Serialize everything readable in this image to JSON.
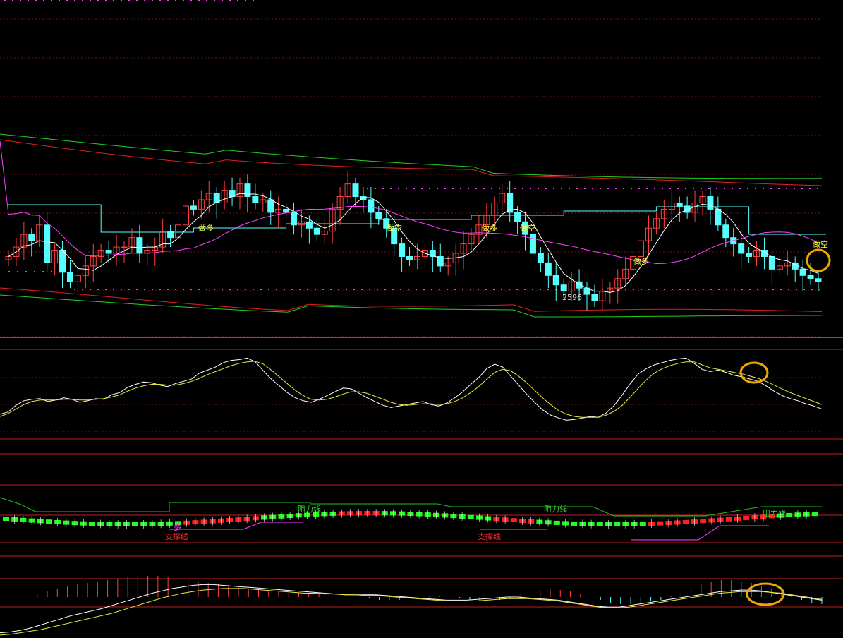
{
  "colors": {
    "background": "#000000",
    "grid": "#7a1010",
    "separator": "#c02020",
    "candle_up": "#ff4040",
    "candle_down": "#55ffff",
    "ma_white": "#ffffff",
    "ma_magenta": "#ff40ff",
    "band_green": "#20d020",
    "band_red": "#e02020",
    "step_cyan": "#55ffff",
    "dot_magenta": "#ff40ff",
    "dot_green": "#20d020",
    "osc_white": "#ffffff",
    "osc_yellow": "#e8e840",
    "label_yellow": "#ffff40",
    "label_green": "#30d030",
    "label_red": "#ff3030",
    "highlight": "#f0a800"
  },
  "labels": {
    "long_1": "做多",
    "short_1": "做空",
    "long_2": "做多",
    "short_2": "做空",
    "long_3": "做多",
    "short_3": "做空",
    "low_value": "2596",
    "resistance_1": "阻力线",
    "resistance_2": "阻力线",
    "resistance_3": "阻力线",
    "support_1": "支撑线",
    "support_2": "支撑线",
    "long_small": "多"
  },
  "chart_data": [
    {
      "type": "candlestick",
      "panel": "price",
      "closes": [
        2612,
        2618,
        2626,
        2622,
        2632,
        2608,
        2616,
        2602,
        2596,
        2600,
        2606,
        2612,
        2616,
        2614,
        2618,
        2618,
        2624,
        2614,
        2616,
        2618,
        2628,
        2624,
        2632,
        2644,
        2642,
        2648,
        2652,
        2646,
        2654,
        2650,
        2658,
        2650,
        2646,
        2648,
        2640,
        2642,
        2640,
        2632,
        2634,
        2630,
        2626,
        2628,
        2642,
        2650,
        2658,
        2650,
        2648,
        2640,
        2636,
        2630,
        2620,
        2612,
        2610,
        2612,
        2616,
        2612,
        2606,
        2608,
        2614,
        2620,
        2626,
        2632,
        2638,
        2646,
        2652,
        2640,
        2634,
        2626,
        2614,
        2608,
        2600,
        2594,
        2590,
        2596,
        2592,
        2588,
        2584,
        2590,
        2592,
        2598,
        2604,
        2612,
        2622,
        2630,
        2636,
        2642,
        2646,
        2644,
        2640,
        2646,
        2650,
        2642,
        2632,
        2624,
        2620,
        2614,
        2612,
        2616,
        2612,
        2604,
        2606,
        2608,
        2604,
        2600,
        2598,
        2596
      ]
    },
    {
      "type": "line",
      "panel": "oscillator",
      "series": [
        {
          "name": "",
          "values": [
            -64,
            -58,
            -40,
            -28,
            -24,
            -22,
            -30,
            -26,
            -20,
            -24,
            -32,
            -28,
            -22,
            -24,
            -12,
            -6,
            8,
            16,
            22,
            20,
            14,
            10,
            18,
            24,
            30,
            46,
            54,
            62,
            74,
            80,
            82,
            86,
            76,
            52,
            30,
            12,
            -6,
            -20,
            -28,
            -32,
            -24,
            -14,
            -4,
            6,
            4,
            -8,
            -20,
            -30,
            -40,
            -46,
            -42,
            -38,
            -34,
            -30,
            -38,
            -42,
            -34,
            -20,
            -4,
            16,
            34,
            58,
            70,
            62,
            38,
            14,
            -10,
            -32,
            -52,
            -66,
            -74,
            -80,
            -78,
            -74,
            -70,
            -72,
            -60,
            -40,
            -12,
            18,
            44,
            58,
            68,
            74,
            80,
            84,
            86,
            72,
            56,
            50,
            54,
            48,
            40,
            36,
            30,
            24,
            12,
            -2,
            -14,
            -22,
            -28,
            -36,
            -42,
            -50
          ]
        },
        {
          "name": "",
          "values": [
            -70,
            -62,
            -50,
            -38,
            -30,
            -26,
            -26,
            -26,
            -24,
            -24,
            -26,
            -26,
            -24,
            -22,
            -18,
            -12,
            -2,
            6,
            12,
            16,
            16,
            14,
            14,
            18,
            24,
            32,
            42,
            50,
            58,
            66,
            72,
            76,
            78,
            70,
            54,
            36,
            18,
            0,
            -14,
            -24,
            -26,
            -24,
            -18,
            -10,
            -4,
            -4,
            -8,
            -16,
            -24,
            -32,
            -38,
            -40,
            -38,
            -36,
            -36,
            -38,
            -36,
            -30,
            -20,
            -6,
            10,
            30,
            48,
            56,
            52,
            38,
            20,
            0,
            -20,
            -38,
            -54,
            -64,
            -70,
            -72,
            -72,
            -72,
            -66,
            -56,
            -40,
            -18,
            6,
            28,
            46,
            58,
            66,
            72,
            76,
            76,
            68,
            60,
            56,
            52,
            48,
            44,
            38,
            32,
            24,
            14,
            4,
            -6,
            -14,
            -22,
            -30,
            -38
          ]
        }
      ]
    },
    {
      "type": "line",
      "panel": "macd",
      "series": [
        {
          "name": "",
          "values": [
            -92,
            -90,
            -86,
            -80,
            -72,
            -64,
            -56,
            -48,
            -42,
            -36,
            -30,
            -22,
            -14,
            -6,
            2,
            10,
            16,
            22,
            26,
            30,
            32,
            32,
            30,
            28,
            26,
            24,
            22,
            20,
            18,
            16,
            14,
            12,
            10,
            8,
            6,
            6,
            6,
            6,
            4,
            2,
            0,
            -2,
            -4,
            -6,
            -8,
            -8,
            -8,
            -6,
            -4,
            -2,
            0,
            0,
            -2,
            -4,
            -6,
            -8,
            -12,
            -16,
            -20,
            -24,
            -26,
            -26,
            -22,
            -18,
            -14,
            -10,
            -6,
            -2,
            2,
            6,
            10,
            14,
            16,
            18,
            18,
            16,
            12,
            8,
            4,
            0,
            -4,
            -8
          ]
        },
        {
          "name": "",
          "values": [
            -98,
            -96,
            -92,
            -88,
            -84,
            -78,
            -72,
            -66,
            -60,
            -54,
            -48,
            -42,
            -34,
            -26,
            -18,
            -10,
            -2,
            4,
            10,
            14,
            18,
            20,
            22,
            22,
            22,
            20,
            18,
            16,
            14,
            12,
            10,
            10,
            8,
            8,
            6,
            6,
            4,
            4,
            2,
            0,
            -2,
            -4,
            -6,
            -8,
            -10,
            -10,
            -10,
            -10,
            -8,
            -6,
            -4,
            -4,
            -4,
            -6,
            -8,
            -10,
            -14,
            -18,
            -22,
            -26,
            -28,
            -28,
            -26,
            -22,
            -18,
            -14,
            -10,
            -6,
            -2,
            2,
            6,
            10,
            12,
            14,
            14,
            14,
            12,
            10,
            6,
            2,
            -2,
            -6
          ]
        }
      ],
      "histogram": [
        0,
        0,
        0,
        4,
        8,
        12,
        16,
        18,
        20,
        22,
        24,
        26,
        28,
        30,
        30,
        30,
        28,
        26,
        24,
        22,
        20,
        18,
        16,
        14,
        12,
        10,
        8,
        8,
        6,
        6,
        4,
        4,
        2,
        2,
        0,
        0,
        -2,
        -4,
        -4,
        -4,
        -2,
        0,
        2,
        2,
        0,
        -2,
        -4,
        -6,
        -6,
        -4,
        -2,
        2,
        6,
        10,
        12,
        10,
        8,
        4,
        0,
        -4,
        -8,
        -10,
        -10,
        -8,
        -6,
        -4,
        2,
        8,
        14,
        18,
        22,
        24,
        24,
        22,
        20,
        16,
        12,
        8,
        2,
        -4,
        -8,
        -10
      ]
    }
  ]
}
